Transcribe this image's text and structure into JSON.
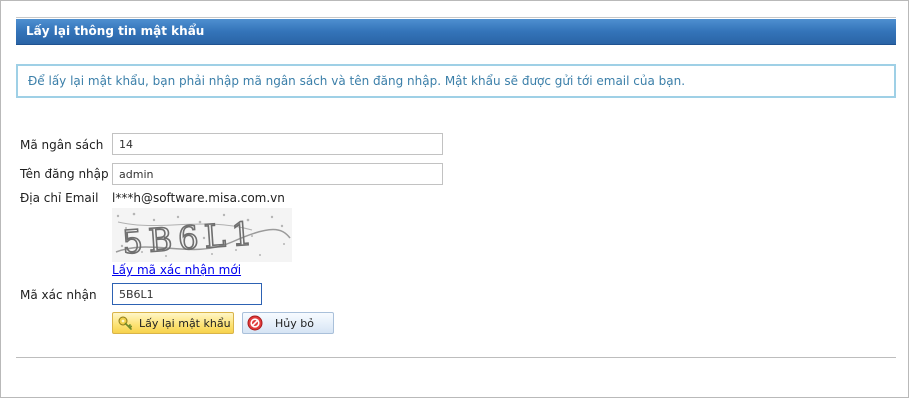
{
  "header": {
    "title": "Lấy lại thông tin mật khẩu"
  },
  "info": {
    "text": "Để lấy lại mật khẩu, bạn phải nhập mã ngân sách và tên đăng nhập. Mật khẩu sẽ được gửi tới email của bạn."
  },
  "form": {
    "budget_code": {
      "label": "Mã ngân sách",
      "value": "14"
    },
    "username": {
      "label": "Tên đăng nhập",
      "value": "admin"
    },
    "email": {
      "label": "Địa chỉ Email",
      "value": "l***h@software.misa.com.vn"
    },
    "captcha": {
      "image_text": "5B6L1",
      "refresh_link": "Lấy mã xác nhận mới"
    },
    "verification_code": {
      "label": "Mã xác nhận",
      "value": "5B6L1"
    }
  },
  "buttons": {
    "recover_label": "Lấy lại mật khẩu",
    "cancel_label": "Hủy bỏ"
  },
  "colors": {
    "header_blue": "#3474b9",
    "info_border": "#9fd0e6",
    "info_text": "#3b7fa9",
    "link": "#0000ee"
  },
  "icons": {
    "recover_button": "key-icon",
    "cancel_button": "cancel-icon"
  }
}
